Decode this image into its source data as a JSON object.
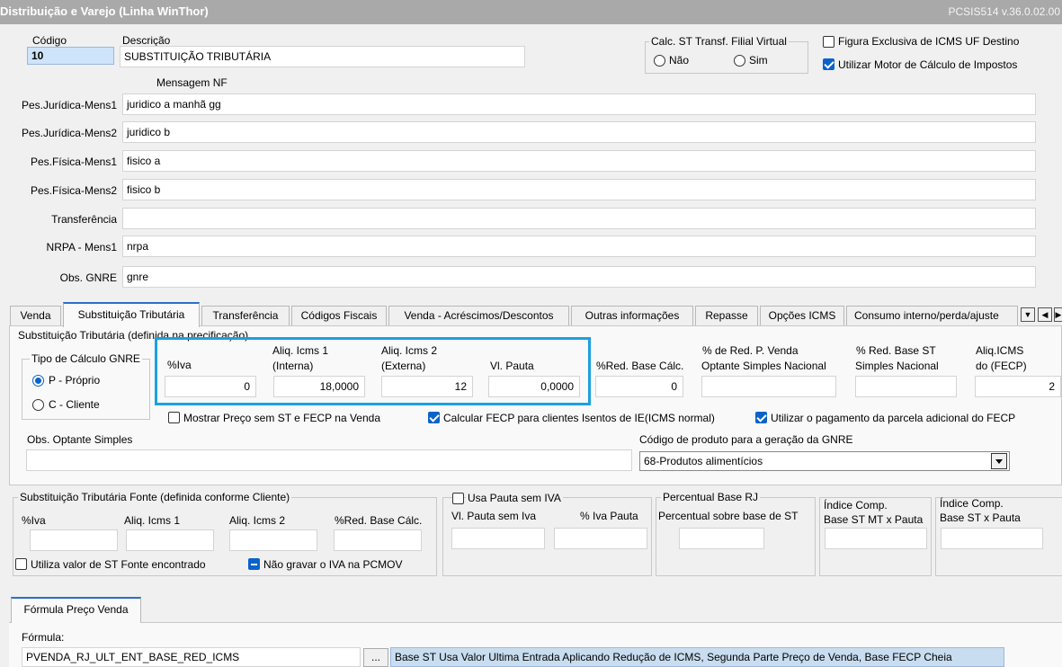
{
  "window": {
    "title": "Distribuição e Varejo (Linha WinThor)",
    "version": "PCSIS514  v.36.0.02.00"
  },
  "header": {
    "codigo_label": "Código",
    "codigo_value": "10",
    "descricao_label": "Descrição",
    "descricao_value": "SUBSTITUIÇÃO TRIBUTÁRIA",
    "calc_st_group": "Calc. ST Transf. Filial Virtual",
    "radio_nao": "Não",
    "radio_sim": "Sim",
    "figura_exclusiva": "Figura Exclusiva de ICMS UF Destino",
    "utilizar_motor": "Utilizar Motor de Cálculo de Impostos",
    "mensagem_nf": "Mensagem NF"
  },
  "mensagens": [
    {
      "label": "Pes.Jurídica-Mens1",
      "value": "juridico a manhã gg"
    },
    {
      "label": "Pes.Jurídica-Mens2",
      "value": "juridico b"
    },
    {
      "label": "Pes.Física-Mens1",
      "value": "fisico a"
    },
    {
      "label": "Pes.Física-Mens2",
      "value": "fisico b"
    },
    {
      "label": "Transferência",
      "value": ""
    },
    {
      "label": "NRPA - Mens1",
      "value": "nrpa"
    },
    {
      "label": "Obs. GNRE",
      "value": "gnre"
    }
  ],
  "tabs": [
    "Venda",
    "Substituição Tributária",
    "Transferência",
    "Códigos Fiscais",
    "Venda - Acréscimos/Descontos",
    "Outras informações",
    "Repasse",
    "Opções ICMS",
    "Consumo interno/perda/ajuste"
  ],
  "st": {
    "group_title": "Substituição Tributária (definida na precificação)",
    "tipo_calculo_title": "Tipo de Cálculo GNRE",
    "tipo_p": "P - Próprio",
    "tipo_c": "C - Cliente",
    "iva_label": "%Iva",
    "iva_value": "0",
    "aliq1_label_1": "Aliq. Icms 1",
    "aliq1_label_2": "(Interna)",
    "aliq1_value": "18,0000",
    "aliq2_label_1": "Aliq. Icms 2",
    "aliq2_label_2": "(Externa)",
    "aliq2_value": "12",
    "pauta_label": "Vl. Pauta",
    "pauta_value": "0,0000",
    "red_base_label": "%Red. Base Cálc.",
    "red_base_value": "0",
    "red_pvenda_1": "% de Red. P. Venda",
    "red_pvenda_2": "Optante Simples Nacional",
    "red_pvenda_value": "",
    "red_st_1": "% Red. Base ST",
    "red_st_2": "Simples Nacional",
    "red_st_value": "",
    "aliq_fecp_1": "Aliq.ICMS",
    "aliq_fecp_2": "do (FECP)",
    "aliq_fecp_value": "2",
    "mostrar_preco": "Mostrar Preço sem ST e FECP na Venda",
    "calcular_fecp": "Calcular FECP para clientes Isentos de IE(ICMS normal)",
    "utilizar_pagamento": "Utilizar o pagamento da parcela adicional do FECP",
    "obs_optante_label": "Obs. Optante Simples",
    "obs_optante_value": "",
    "cod_gnre_label": "Código de produto para a geração da GNRE",
    "cod_gnre_value": "68-Produtos alimentícios"
  },
  "fonte": {
    "group_title": "Substituição Tributária Fonte (definida conforme Cliente)",
    "iva_label": "%Iva",
    "aliq1_label": "Aliq. Icms 1",
    "aliq2_label": "Aliq. Icms 2",
    "red_label": "%Red. Base Cálc.",
    "utiliza_valor": "Utiliza valor de ST Fonte encontrado",
    "nao_gravar": "Não gravar o IVA na PCMOV"
  },
  "pauta": {
    "usa_pauta": "Usa Pauta sem IVA",
    "vl_pauta_label": "Vl. Pauta sem Iva",
    "iva_pauta_label": "% Iva Pauta"
  },
  "perc_rj": {
    "title": "Percentual Base RJ",
    "label": "Percentual sobre base de ST"
  },
  "indice_mt": {
    "label_1": "Índice Comp.",
    "label_2": "Base ST MT x Pauta"
  },
  "indice": {
    "label_1": "Índice Comp.",
    "label_2": "Base ST x Pauta"
  },
  "formula": {
    "tab": "Fórmula Preço Venda",
    "label": "Fórmula:",
    "value": "PVENDA_RJ_ULT_ENT_BASE_RED_ICMS",
    "browse": "...",
    "description": "Base ST Usa Valor Ultima Entrada Aplicando Redução de ICMS, Segunda Parte Preço de Venda, Base FECP Cheia"
  }
}
